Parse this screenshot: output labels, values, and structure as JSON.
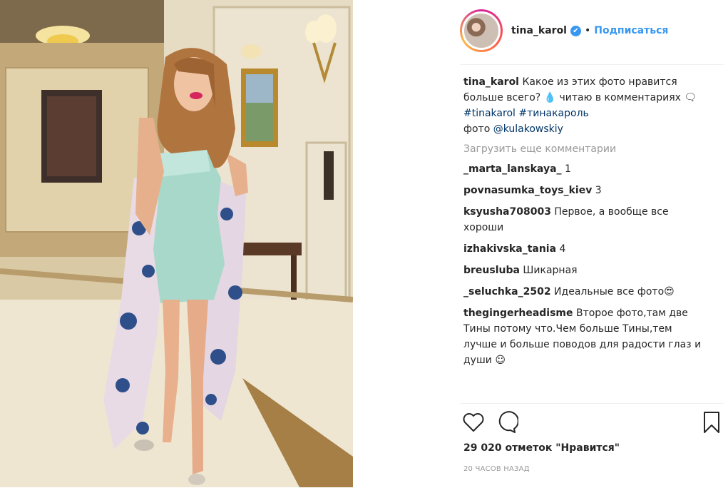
{
  "post": {
    "author": "tina_karol",
    "follow_label": "Подписаться",
    "separator": "•",
    "verified_icon": "verified-badge-icon",
    "accent_color": "#3897f0"
  },
  "caption": {
    "user": "tina_karol",
    "text": "Какое из этих фото нравится больше всего? 💧 читаю в комментариях 🗨",
    "hashtags": [
      "#tinakarol",
      "#тинакароль"
    ],
    "photo_credit_prefix": "фото",
    "photo_credit_user": "@kulakowskiy"
  },
  "load_more_label": "Загрузить еще комментарии",
  "comments": [
    {
      "user": "_marta_lanskaya_",
      "text": "1"
    },
    {
      "user": "povnasumka_toys_kiev",
      "text": "3"
    },
    {
      "user": "ksyusha708003",
      "text": "Первое, а вообще все хороши"
    },
    {
      "user": "izhakivska_tania",
      "text": "4"
    },
    {
      "user": "breusluba",
      "text": "Шикарная"
    },
    {
      "user": "_seluchka_2502",
      "text": "Идеальные все фото😍"
    },
    {
      "user": "thegingerheadisme",
      "text": "Второе фото,там две Тины потому что.Чем больше Тины,тем лучше и больше поводов для радости глаз и души ☺"
    }
  ],
  "actions": {
    "like_icon": "heart-icon",
    "comment_icon": "comment-bubble-icon",
    "save_icon": "bookmark-icon"
  },
  "likes_label": "29 020 отметок \"Нравится\"",
  "timestamp": "20 ЧАСОВ НАЗАД"
}
